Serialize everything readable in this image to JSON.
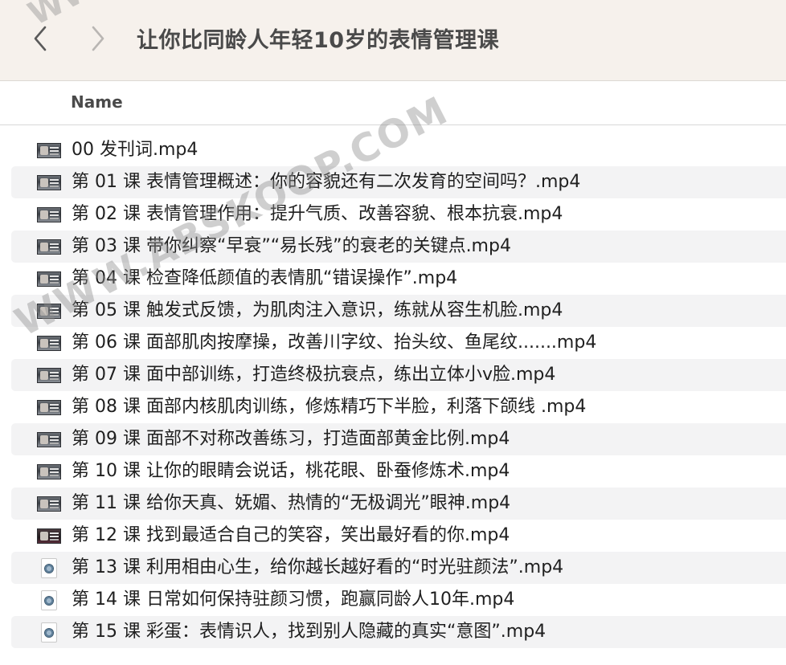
{
  "window": {
    "title": "让你比同龄人年轻10岁的表情管理课"
  },
  "toolbar": {
    "back_icon": "chevron-left-icon",
    "forward_icon": "chevron-right-icon"
  },
  "columns": {
    "name_label": "Name"
  },
  "files": [
    {
      "name": "00 发刊词.mp4",
      "icon": "video-thumbnail"
    },
    {
      "name": "第 01 课  表情管理概述：你的容貌还有二次发育的空间吗？.mp4",
      "icon": "video-thumbnail"
    },
    {
      "name": "第 02 课  表情管理作用：提升气质、改善容貌、根本抗衰.mp4",
      "icon": "video-thumbnail"
    },
    {
      "name": "第 03 课  带你纠察“早衰”“易长残”的衰老的关键点.mp4",
      "icon": "video-thumbnail"
    },
    {
      "name": "第 04 课  检查降低颜值的表情肌“错误操作”.mp4",
      "icon": "video-thumbnail"
    },
    {
      "name": "第 05 课  触发式反馈，为肌肉注入意识，练就从容生机脸.mp4",
      "icon": "video-thumbnail"
    },
    {
      "name": "第 06 课  面部肌肉按摩操，改善川字纹、抬头纹、鱼尾纹.......mp4",
      "icon": "video-thumbnail"
    },
    {
      "name": "第 07 课  面中部训练，打造终极抗衰点，练出立体小v脸.mp4",
      "icon": "video-thumbnail"
    },
    {
      "name": "第 08 课  面部内核肌肉训练，修炼精巧下半脸，利落下颌线 .mp4",
      "icon": "video-thumbnail"
    },
    {
      "name": "第 09 课  面部不对称改善练习，打造面部黄金比例.mp4",
      "icon": "video-thumbnail"
    },
    {
      "name": "第 10 课  让你的眼睛会说话，桃花眼、卧蚕修炼术.mp4",
      "icon": "video-thumbnail"
    },
    {
      "name": "第 11 课  给你天真、妩媚、热情的“无极调光”眼神.mp4",
      "icon": "video-thumbnail"
    },
    {
      "name": "第 12 课  找到最适合自己的笑容，笑出最好看的你.mp4",
      "icon": "video-thumbnail-dark"
    },
    {
      "name": "第 13 课  利用相由心生，给你越长越好看的“时光驻颜法”.mp4",
      "icon": "quicktime-file-icon"
    },
    {
      "name": "第 14 课  日常如何保持驻颜习惯，跑赢同龄人10年.mp4",
      "icon": "quicktime-file-icon"
    },
    {
      "name": "第 15 课  彩蛋：表情识人，找到别人隐藏的真实“意图”.mp4",
      "icon": "quicktime-file-icon"
    }
  ],
  "watermark": {
    "main": "WWW.ABSKOOP.COM",
    "top": "WWW"
  }
}
